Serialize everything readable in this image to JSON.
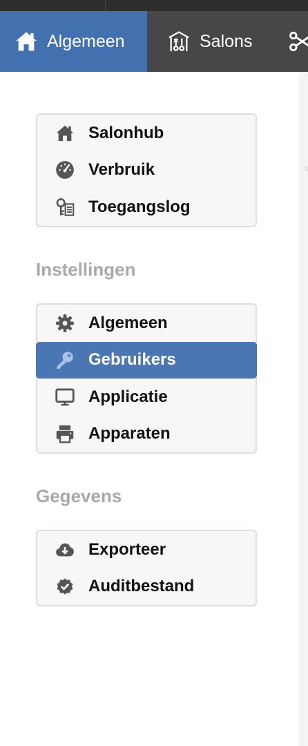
{
  "nav": {
    "tabs": [
      {
        "label": "Algemeen",
        "icon": "home-icon",
        "active": true
      },
      {
        "label": "Salons",
        "icon": "salon-icon",
        "active": false
      },
      {
        "label": "",
        "icon": "scissors-icon",
        "active": false
      }
    ]
  },
  "menu_main": {
    "items": [
      {
        "label": "Salonhub",
        "icon": "home-icon"
      },
      {
        "label": "Verbruik",
        "icon": "speedometer-icon"
      },
      {
        "label": "Toegangslog",
        "icon": "key-list-icon"
      }
    ]
  },
  "settings": {
    "title": "Instellingen",
    "items": [
      {
        "label": "Algemeen",
        "icon": "gear-icon",
        "active": false
      },
      {
        "label": "Gebruikers",
        "icon": "key-icon",
        "active": true
      },
      {
        "label": "Applicatie",
        "icon": "monitor-icon",
        "active": false
      },
      {
        "label": "Apparaten",
        "icon": "printer-icon",
        "active": false
      }
    ]
  },
  "data_section": {
    "title": "Gegevens",
    "items": [
      {
        "label": "Exporteer",
        "icon": "cloud-download-icon"
      },
      {
        "label": "Auditbestand",
        "icon": "certificate-check-icon"
      }
    ]
  },
  "colors": {
    "active_blue": "#4a77b4",
    "nav_background": "#474747",
    "section_title_gray": "#a9a9a9"
  }
}
